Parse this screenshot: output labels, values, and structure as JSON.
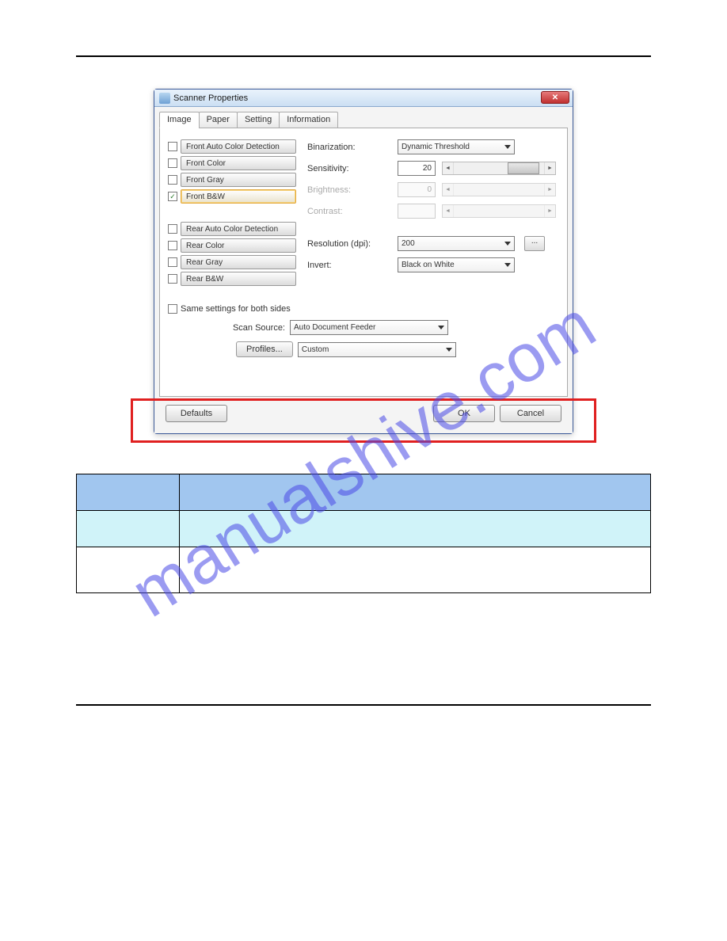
{
  "watermark": "manualshive.com",
  "dialog": {
    "title": "Scanner Properties",
    "close": "✕",
    "tabs": [
      "Image",
      "Paper",
      "Setting",
      "Information"
    ],
    "active_tab_index": 0,
    "front": {
      "auto_color": "Front Auto Color Detection",
      "color": "Front Color",
      "gray": "Front Gray",
      "bw_label": "Front B&W",
      "bw_checked": "✓"
    },
    "rear": {
      "auto_color": "Rear Auto Color Detection",
      "color": "Rear Color",
      "gray": "Rear Gray",
      "bw": "Rear B&W"
    },
    "fields": {
      "binarization_label": "Binarization:",
      "binarization_value": "Dynamic Threshold",
      "sensitivity_label": "Sensitivity:",
      "sensitivity_value": "20",
      "brightness_label": "Brightness:",
      "brightness_value": "0",
      "contrast_label": "Contrast:",
      "resolution_label": "Resolution (dpi):",
      "resolution_value": "200",
      "invert_label": "Invert:",
      "invert_value": "Black on White"
    },
    "same_settings_label": "Same settings for both sides",
    "scan_source_label": "Scan Source:",
    "scan_source_value": "Auto Document Feeder",
    "profiles_btn": "Profiles...",
    "profiles_value": "Custom",
    "defaults_btn": "Defaults",
    "ok_btn": "OK",
    "cancel_btn": "Cancel",
    "more_btn": "..."
  }
}
